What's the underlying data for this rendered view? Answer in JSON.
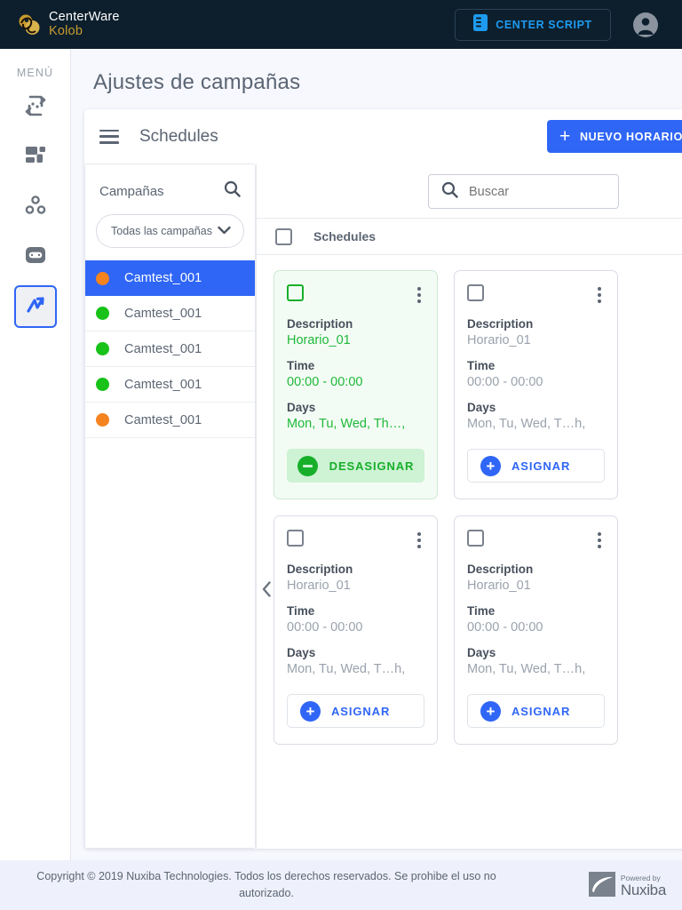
{
  "topbar": {
    "brand_line1": "CenterWare",
    "brand_line2": "Kolob",
    "center_script_label": "CENTER SCRIPT",
    "logo_icon": "centerware-swirl-logo",
    "script_icon": "document-script-icon",
    "avatar_icon": "user-avatar-icon"
  },
  "sidebar": {
    "title": "MENÚ",
    "items": [
      {
        "icon": "transfer-image-icon",
        "active": false
      },
      {
        "icon": "dashboard-grid-icon",
        "active": false
      },
      {
        "icon": "nodes-group-icon",
        "active": false
      },
      {
        "icon": "voicemail-robot-icon",
        "active": false
      },
      {
        "icon": "activity-zigzag-icon",
        "active": true
      }
    ]
  },
  "page": {
    "title": "Ajustes de campañas"
  },
  "panel": {
    "menu_icon": "hamburger-menu-icon",
    "title": "Schedules",
    "new_button_label": "NUEVO HORARIO",
    "new_button_icon": "plus-icon",
    "accent_color": "#2f66f6"
  },
  "campaigns": {
    "label": "Campañas",
    "search_icon": "search-icon",
    "select_value": "Todas las campañas",
    "select_icon": "chevron-down-icon",
    "items": [
      {
        "name": "Camtest_001",
        "status_color": "#f5831f",
        "selected": true
      },
      {
        "name": "Camtest_001",
        "status_color": "#18c219",
        "selected": false
      },
      {
        "name": "Camtest_001",
        "status_color": "#18c219",
        "selected": false
      },
      {
        "name": "Camtest_001",
        "status_color": "#18c219",
        "selected": false
      },
      {
        "name": "Camtest_001",
        "status_color": "#f5831f",
        "selected": false
      }
    ]
  },
  "schedules": {
    "search_placeholder": "Buscar",
    "search_icon": "search-icon",
    "list_header_label": "Schedules",
    "collapse_icon": "chevron-left-icon",
    "field_labels": {
      "description": "Description",
      "time": "Time",
      "days": "Days"
    },
    "cards": [
      {
        "description": "Horario_01",
        "time": "00:00 - 00:00",
        "days": "Mon, Tu, Wed, Th…,",
        "assigned": true,
        "action_label": "DESASIGNAR",
        "action_icon": "minus-circle-icon",
        "kebab_icon": "more-vertical-icon",
        "checkbox_checked": false
      },
      {
        "description": "Horario_01",
        "time": "00:00 - 00:00",
        "days": "Mon, Tu, Wed, T…h,",
        "assigned": false,
        "action_label": "ASIGNAR",
        "action_icon": "plus-circle-icon",
        "kebab_icon": "more-vertical-icon",
        "checkbox_checked": false
      },
      {
        "description": "Horario_01",
        "time": "00:00 - 00:00",
        "days": "Mon, Tu, Wed, T…h,",
        "assigned": false,
        "action_label": "ASIGNAR",
        "action_icon": "plus-circle-icon",
        "kebab_icon": "more-vertical-icon",
        "checkbox_checked": false
      },
      {
        "description": "Horario_01",
        "time": "00:00 - 00:00",
        "days": "Mon, Tu, Wed, T…h,",
        "assigned": false,
        "action_label": "ASIGNAR",
        "action_icon": "plus-circle-icon",
        "kebab_icon": "more-vertical-icon",
        "checkbox_checked": false
      }
    ]
  },
  "footer": {
    "copyright": "Copyright © 2019 Nuxiba Technologies. Todos los derechos reservados. Se prohibe el uso no autorizado.",
    "powered_small": "Powered by",
    "powered_big": "Nuxiba",
    "powered_icon": "nuxiba-swirl-icon"
  }
}
